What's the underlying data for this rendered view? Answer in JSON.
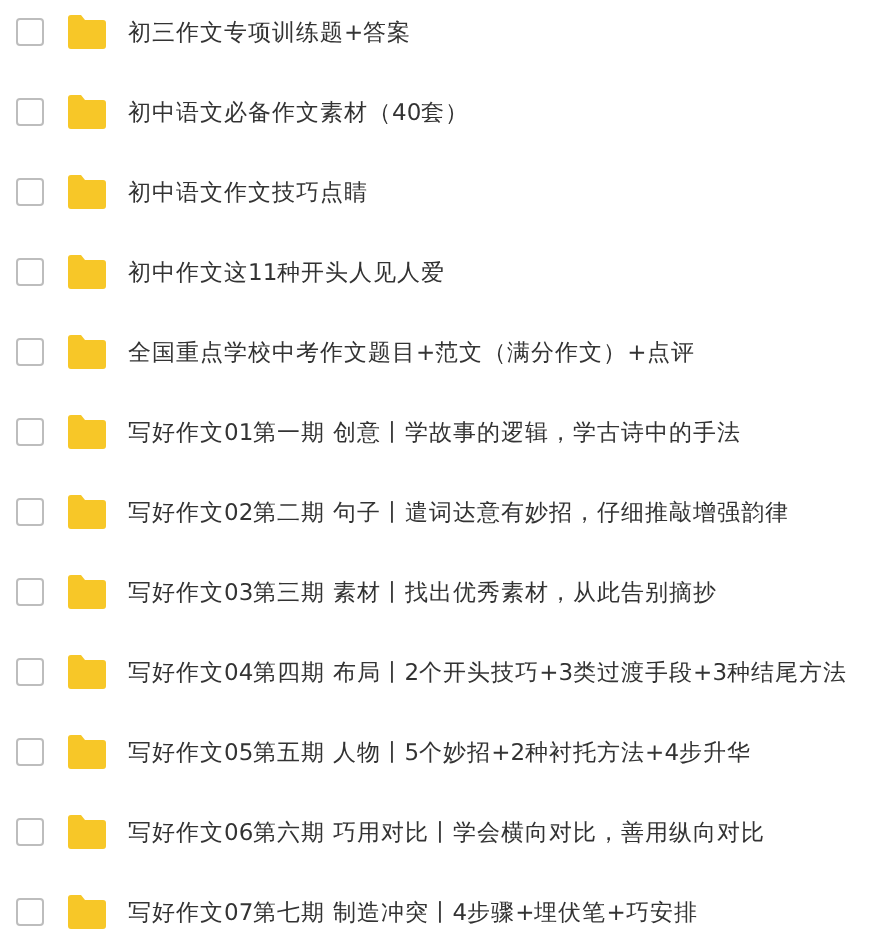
{
  "folders": [
    {
      "name": "初三作文专项训练题+答案",
      "checked": false
    },
    {
      "name": "初中语文必备作文素材（40套）",
      "checked": false
    },
    {
      "name": "初中语文作文技巧点睛",
      "checked": false
    },
    {
      "name": "初中作文这11种开头人见人爱",
      "checked": false
    },
    {
      "name": "全国重点学校中考作文题目+范文（满分作文）+点评",
      "checked": false
    },
    {
      "name": "写好作文01第一期 创意丨学故事的逻辑，学古诗中的手法",
      "checked": false
    },
    {
      "name": "写好作文02第二期 句子丨遣词达意有妙招，仔细推敲增强韵律",
      "checked": false
    },
    {
      "name": "写好作文03第三期 素材丨找出优秀素材，从此告别摘抄",
      "checked": false
    },
    {
      "name": "写好作文04第四期 布局丨2个开头技巧+3类过渡手段+3种结尾方法",
      "checked": false
    },
    {
      "name": "写好作文05第五期 人物丨5个妙招+2种衬托方法+4步升华",
      "checked": false
    },
    {
      "name": "写好作文06第六期 巧用对比丨学会横向对比，善用纵向对比",
      "checked": false
    },
    {
      "name": "写好作文07第七期 制造冲突丨4步骤+埋伏笔+巧安排",
      "checked": false
    }
  ]
}
